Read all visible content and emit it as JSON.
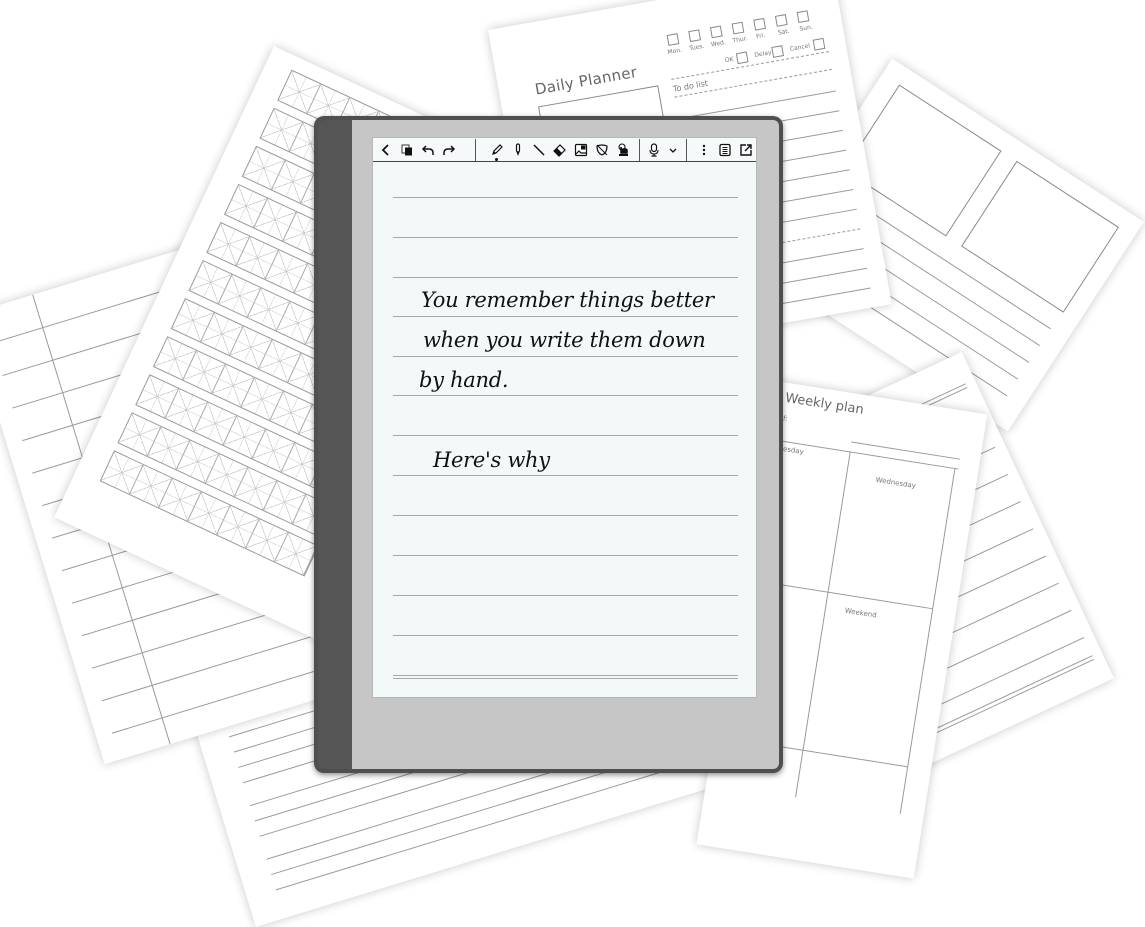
{
  "background_sheets": {
    "daily_planner": {
      "title": "Daily Planner",
      "weekdays": [
        "Mon.",
        "Tues.",
        "Wed.",
        "Thur.",
        "Fri.",
        "Sat.",
        "Sun."
      ],
      "todo_label": "To do list",
      "status_labels": {
        "ok": "OK",
        "delay": "Delay",
        "cancel": "Cancel"
      }
    },
    "weekly_plan": {
      "title": "Weekly plan",
      "week_of_label": "ek of:",
      "day_labels": [
        "Tuesday",
        "Wednesday",
        "ay",
        "Weekend"
      ]
    }
  },
  "device": {
    "toolbar": {
      "left": [
        {
          "icon": "back-icon",
          "glyph": "<"
        },
        {
          "icon": "pages-icon"
        },
        {
          "icon": "undo-icon"
        },
        {
          "icon": "redo-icon"
        }
      ],
      "tools": [
        {
          "icon": "pencil-icon",
          "active": true
        },
        {
          "icon": "marker-icon"
        },
        {
          "icon": "line-icon"
        },
        {
          "icon": "eraser-icon"
        },
        {
          "icon": "image-icon"
        },
        {
          "icon": "lasso-icon"
        },
        {
          "icon": "touch-icon"
        }
      ],
      "voice": [
        {
          "icon": "microphone-icon"
        },
        {
          "icon": "chevron-down-icon"
        }
      ],
      "right": [
        {
          "icon": "more-vertical-icon"
        },
        {
          "icon": "page-list-icon"
        },
        {
          "icon": "export-icon"
        }
      ]
    },
    "handwriting": [
      "You remember things better",
      "when you write them down",
      "by hand.",
      "Here's why"
    ]
  }
}
